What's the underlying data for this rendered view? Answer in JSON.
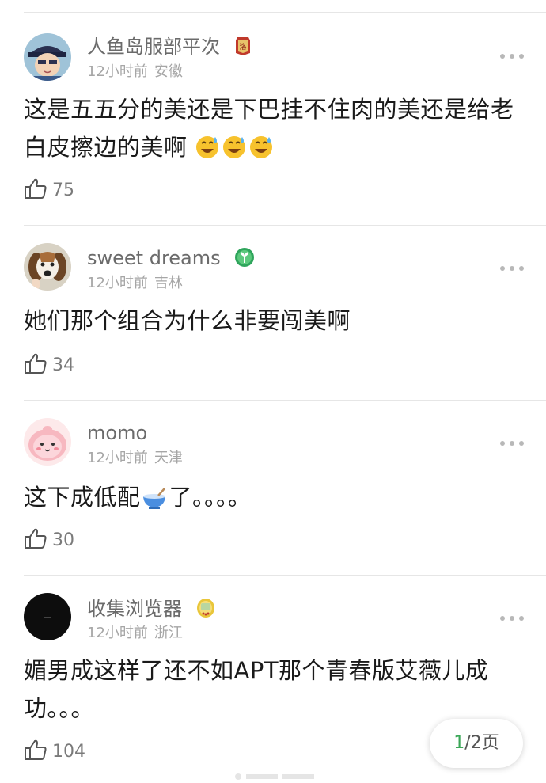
{
  "comments": [
    {
      "username": "人鱼岛服部平次",
      "time": "12小时前",
      "location": "安徽",
      "text": "这是五五分的美还是下巴挂不住肉的美还是给老白皮擦边的美啊",
      "emojis": [
        "sweat-smile-emoji",
        "sweat-smile-emoji",
        "sweat-smile-emoji"
      ],
      "badge": "medal-badge-icon",
      "likes": "75"
    },
    {
      "username": "sweet dreams",
      "time": "12小时前",
      "location": "吉林",
      "text": "她们那个组合为什么非要闯美啊",
      "badge": "sprout-badge-icon",
      "likes": "34"
    },
    {
      "username": "momo",
      "time": "12小时前",
      "location": "天津",
      "text_before": "这下成低配",
      "text_after": "了。。。。",
      "emojis": [
        "bowl-emoji"
      ],
      "likes": "30"
    },
    {
      "username": "收集浏览器",
      "time": "12小时前",
      "location": "浙江",
      "text": "媚男成这样了还不如APT那个青春版艾薇儿成功。。。",
      "badge": "tamagotchi-badge-icon",
      "likes": "104"
    }
  ],
  "pager": {
    "current": "1",
    "rest": "/2页"
  },
  "colors": {
    "username": "#6b6b6b",
    "meta": "#a6a6a6",
    "divider": "#e6e6e6",
    "pager_current": "#3aa757"
  }
}
